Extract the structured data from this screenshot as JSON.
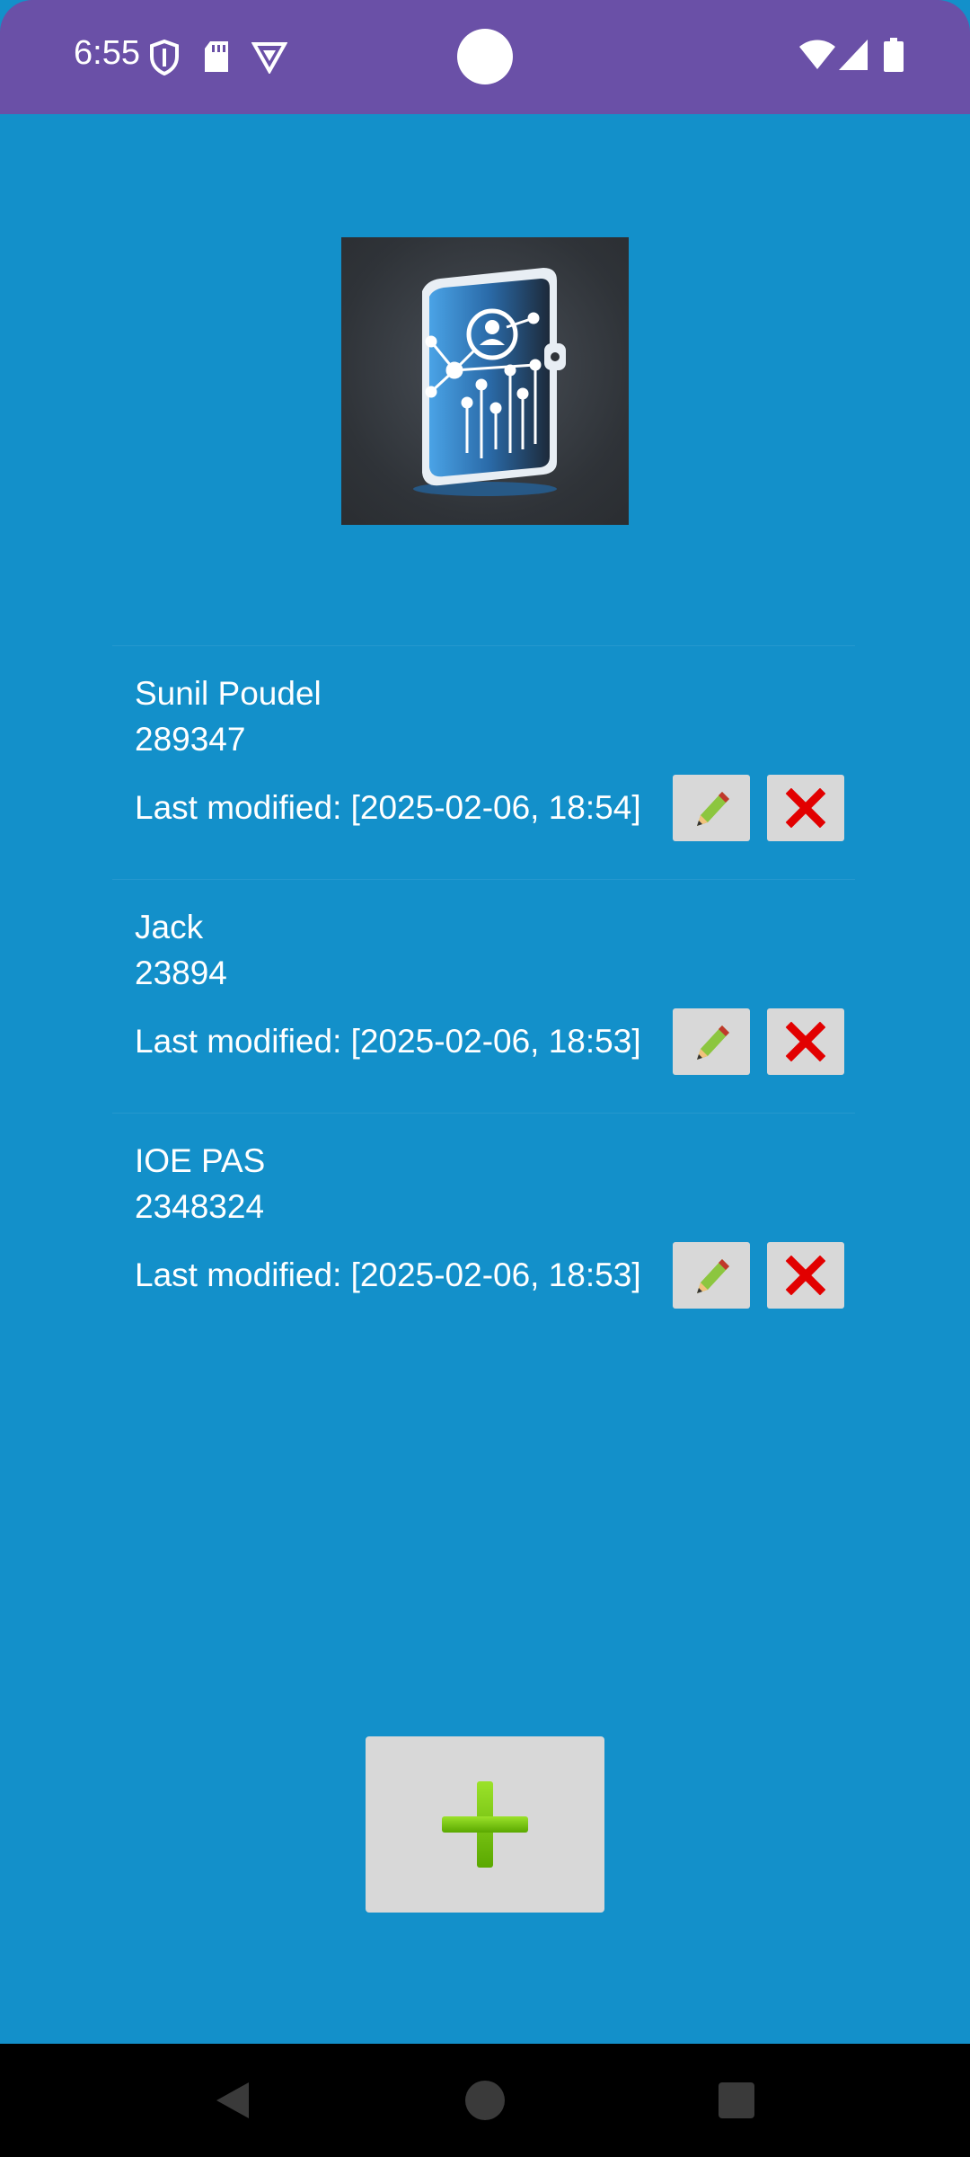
{
  "status_bar": {
    "time": "6:55",
    "icons_left": [
      "shield-icon",
      "sd-card-icon",
      "vpn-icon"
    ],
    "icons_right": [
      "wifi-icon",
      "signal-icon",
      "battery-icon"
    ],
    "color": "#6a50a7"
  },
  "app": {
    "background_color": "#1390ca",
    "logo_icon": "contacts-book-logo"
  },
  "contacts": [
    {
      "name": "Sunil Poudel",
      "number": "289347",
      "modified": "Last modified: [2025-02-06, 18:54]"
    },
    {
      "name": "Jack",
      "number": "23894",
      "modified": "Last modified: [2025-02-06, 18:53]"
    },
    {
      "name": "IOE PAS",
      "number": "2348324",
      "modified": "Last modified: [2025-02-06, 18:53]"
    }
  ],
  "actions": {
    "edit_icon": "pencil-icon",
    "delete_icon": "red-x-icon",
    "add_icon": "green-plus-icon"
  },
  "nav_bar": {
    "buttons": [
      "back-icon",
      "home-icon",
      "recents-icon"
    ]
  }
}
